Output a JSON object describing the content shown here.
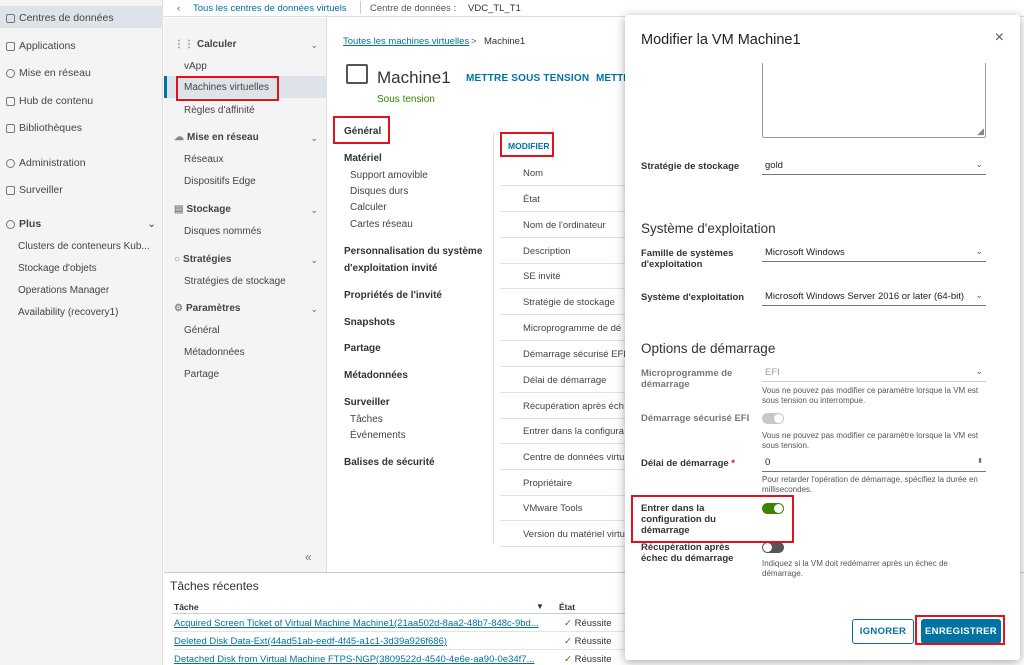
{
  "leftnav": {
    "items": [
      {
        "label": "Centres de données",
        "icon": "datacenter-icon"
      },
      {
        "label": "Applications",
        "icon": "apps-icon"
      },
      {
        "label": "Mise en réseau",
        "icon": "cloud-icon"
      },
      {
        "label": "Hub de contenu",
        "icon": "content-hub-icon"
      },
      {
        "label": "Bibliothèques",
        "icon": "library-icon"
      },
      {
        "label": "Administration",
        "icon": "gear-icon"
      },
      {
        "label": "Surveiller",
        "icon": "monitor-icon"
      },
      {
        "label": "Plus",
        "icon": "plus-icon"
      }
    ],
    "plus_items": [
      "Clusters de conteneurs Kub...",
      "Stockage d'objets",
      "Operations Manager",
      "Availability (recovery1)"
    ]
  },
  "topbar": {
    "back_link": "Tous les centres de données virtuels",
    "datacenter_label": "Centre de données :",
    "datacenter_name": "VDC_TL_T1"
  },
  "secnav": {
    "calculer": {
      "label": "Calculer",
      "items": [
        "vApp",
        "Machines virtuelles",
        "Règles d'affinité"
      ]
    },
    "reseau": {
      "label": "Mise en réseau",
      "items": [
        "Réseaux",
        "Dispositifs Edge"
      ]
    },
    "stockage": {
      "label": "Stockage",
      "items": [
        "Disques nommés"
      ]
    },
    "strategies": {
      "label": "Stratégies",
      "items": [
        "Stratégies de stockage"
      ]
    },
    "parametres": {
      "label": "Paramètres",
      "items": [
        "Général",
        "Métadonnées",
        "Partage"
      ]
    },
    "collapse": "«"
  },
  "main": {
    "breadcrumb_link": "Toutes les machines virtuelles",
    "breadcrumb_sep": ">",
    "breadcrumb_current": "Machine1",
    "vm_name": "Machine1",
    "vm_status": "Sous tension",
    "action_power": "METTRE SOUS TENSION",
    "action_more": "METTRE",
    "modify": "MODIFIER",
    "properties": {
      "general": "Général",
      "materiel": "Matériel",
      "materiel_items": [
        "Support amovible",
        "Disques durs",
        "Calculer",
        "Cartes réseau"
      ],
      "personnalisation_1": "Personnalisation du système",
      "personnalisation_2": "d'exploitation invité",
      "proprietes": "Propriétés de l'invité",
      "snapshots": "Snapshots",
      "partage": "Partage",
      "metadonnees": "Métadonnées",
      "surveiller": "Surveiller",
      "surveiller_items": [
        "Tâches",
        "Événements"
      ],
      "balises": "Balises de sécurité"
    },
    "grid": [
      "Nom",
      "État",
      "Nom de l'ordinateur",
      "Description",
      "SE invité",
      "Stratégie de stockage",
      "Microprogramme de dé",
      "Démarrage sécurisé EFI",
      "Délai de démarrage",
      "Récupération après éch",
      "Entrer dans la configura",
      "Centre de données virtu",
      "Propriétaire",
      "VMware Tools",
      "Version du matériel virtu"
    ]
  },
  "tasks": {
    "title": "Tâches récentes",
    "col_task": "Tâche",
    "col_status": "État",
    "rows": [
      {
        "task": "Acquired Screen Ticket of Virtual Machine Machine1(21aa502d-8aa2-48b7-848c-9bd...",
        "status": "Réussite"
      },
      {
        "task": "Deleted Disk Data-Ext(44ad51ab-eedf-4f45-a1c1-3d39a926f686)",
        "status": "Réussite"
      },
      {
        "task": "Detached Disk from Virtual Machine FTPS-NGP(3809522d-4540-4e6e-aa90-0e34f7...",
        "status": "Réussite"
      }
    ]
  },
  "modal": {
    "title": "Modifier la VM Machine1",
    "storage_label": "Stratégie de stockage",
    "storage_value": "gold",
    "os_section": "Système d'exploitation",
    "os_family_label": "Famille de systèmes d'exploitation",
    "os_family_value": "Microsoft Windows",
    "os_label": "Système d'exploitation",
    "os_value": "Microsoft Windows Server 2016 or later (64-bit)",
    "boot_section": "Options de démarrage",
    "firmware_label": "Microprogramme de démarrage",
    "firmware_value": "EFI",
    "firmware_help": "Vous ne pouvez pas modifier ce paramètre lorsque la VM est sous tension ou interrompue.",
    "secure_boot_label": "Démarrage sécurisé EFI",
    "secure_boot_help": "Vous ne pouvez pas modifier ce paramètre lorsque la VM est sous tension.",
    "delay_label": "Délai de démarrage",
    "delay_required": "*",
    "delay_value": "0",
    "delay_help": "Pour retarder l'opération de démarrage, spécifiez la durée en millisecondes.",
    "enter_setup_label": "Entrer dans la configuration du démarrage",
    "recovery_label": "Récupération après échec du démarrage",
    "recovery_help": "Indiquez si la VM doit redémarrer après un échec de démarrage.",
    "cancel": "IGNORER",
    "save": "ENREGISTRER"
  },
  "colors": {
    "accent": "#0072a3",
    "highlight": "#e0121b",
    "toggle_on": "#3c8500",
    "status_green": "#318700"
  }
}
